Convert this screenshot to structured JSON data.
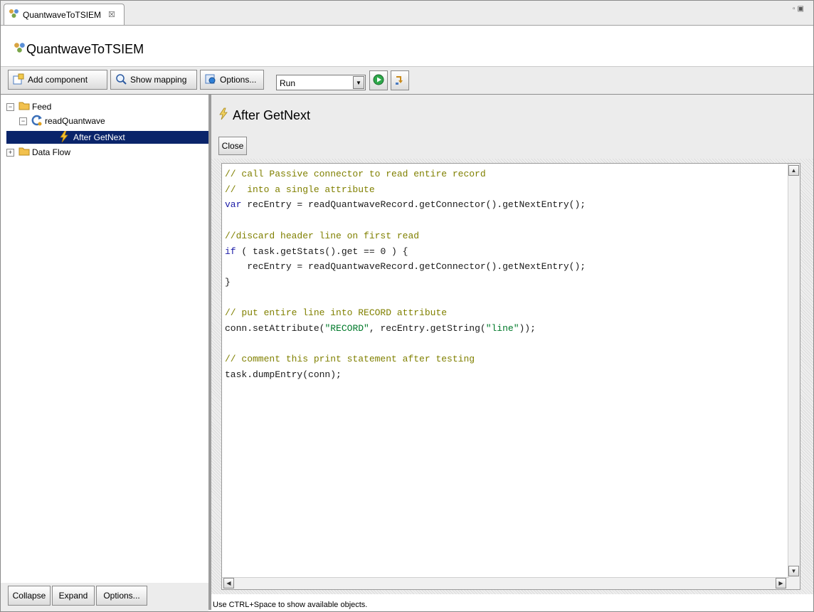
{
  "tab": {
    "label": "QuantwaveToTSIEM",
    "close": "☒"
  },
  "window_controls": "– ̅",
  "page_title": "QuantwaveToTSIEM",
  "toolbar": {
    "add_component": "Add component",
    "show_mapping": "Show mapping",
    "options": "Options...",
    "mode_selected": "Run"
  },
  "tree": {
    "items": [
      {
        "label": "Feed",
        "expander": "−"
      },
      {
        "label": "readQuantwave",
        "expander": "−"
      },
      {
        "label": "After GetNext",
        "selected": true
      },
      {
        "label": "Data Flow",
        "expander": "+"
      }
    ]
  },
  "left_buttons": {
    "collapse": "Collapse",
    "expand": "Expand",
    "options": "Options..."
  },
  "section": {
    "title": "After GetNext",
    "close": "Close"
  },
  "code_lines": [
    [
      {
        "t": "// call Passive connector to read entire record",
        "c": "comment"
      }
    ],
    [
      {
        "t": "//  into a single attribute",
        "c": "comment"
      }
    ],
    [
      {
        "t": "var",
        "c": "kw"
      },
      {
        "t": " recEntry = readQuantwaveRecord.getConnector().getNextEntry();",
        "c": "plain"
      }
    ],
    [
      {
        "t": "",
        "c": "plain"
      }
    ],
    [
      {
        "t": "//discard header line on first read",
        "c": "comment"
      }
    ],
    [
      {
        "t": "if",
        "c": "kw"
      },
      {
        "t": " ( task.getStats().get == 0 ) {",
        "c": "plain"
      }
    ],
    [
      {
        "t": "    recEntry = readQuantwaveRecord.getConnector().getNextEntry();",
        "c": "plain"
      }
    ],
    [
      {
        "t": "}",
        "c": "plain"
      }
    ],
    [
      {
        "t": "",
        "c": "plain"
      }
    ],
    [
      {
        "t": "// put entire line into RECORD attribute",
        "c": "comment"
      }
    ],
    [
      {
        "t": "conn.setAttribute(",
        "c": "plain"
      },
      {
        "t": "\"RECORD\"",
        "c": "str"
      },
      {
        "t": ", recEntry.getString(",
        "c": "plain"
      },
      {
        "t": "\"line\"",
        "c": "str"
      },
      {
        "t": "));",
        "c": "plain"
      }
    ],
    [
      {
        "t": "",
        "c": "plain"
      }
    ],
    [
      {
        "t": "// comment this print statement after testing",
        "c": "comment"
      }
    ],
    [
      {
        "t": "task.dumpEntry(conn);",
        "c": "plain"
      }
    ]
  ],
  "status_text": "Use CTRL+Space to show available objects.",
  "colors": {
    "selection": "#0a246a",
    "comment": "#808000",
    "keyword": "#1a1aa6",
    "string": "#007a2a"
  }
}
